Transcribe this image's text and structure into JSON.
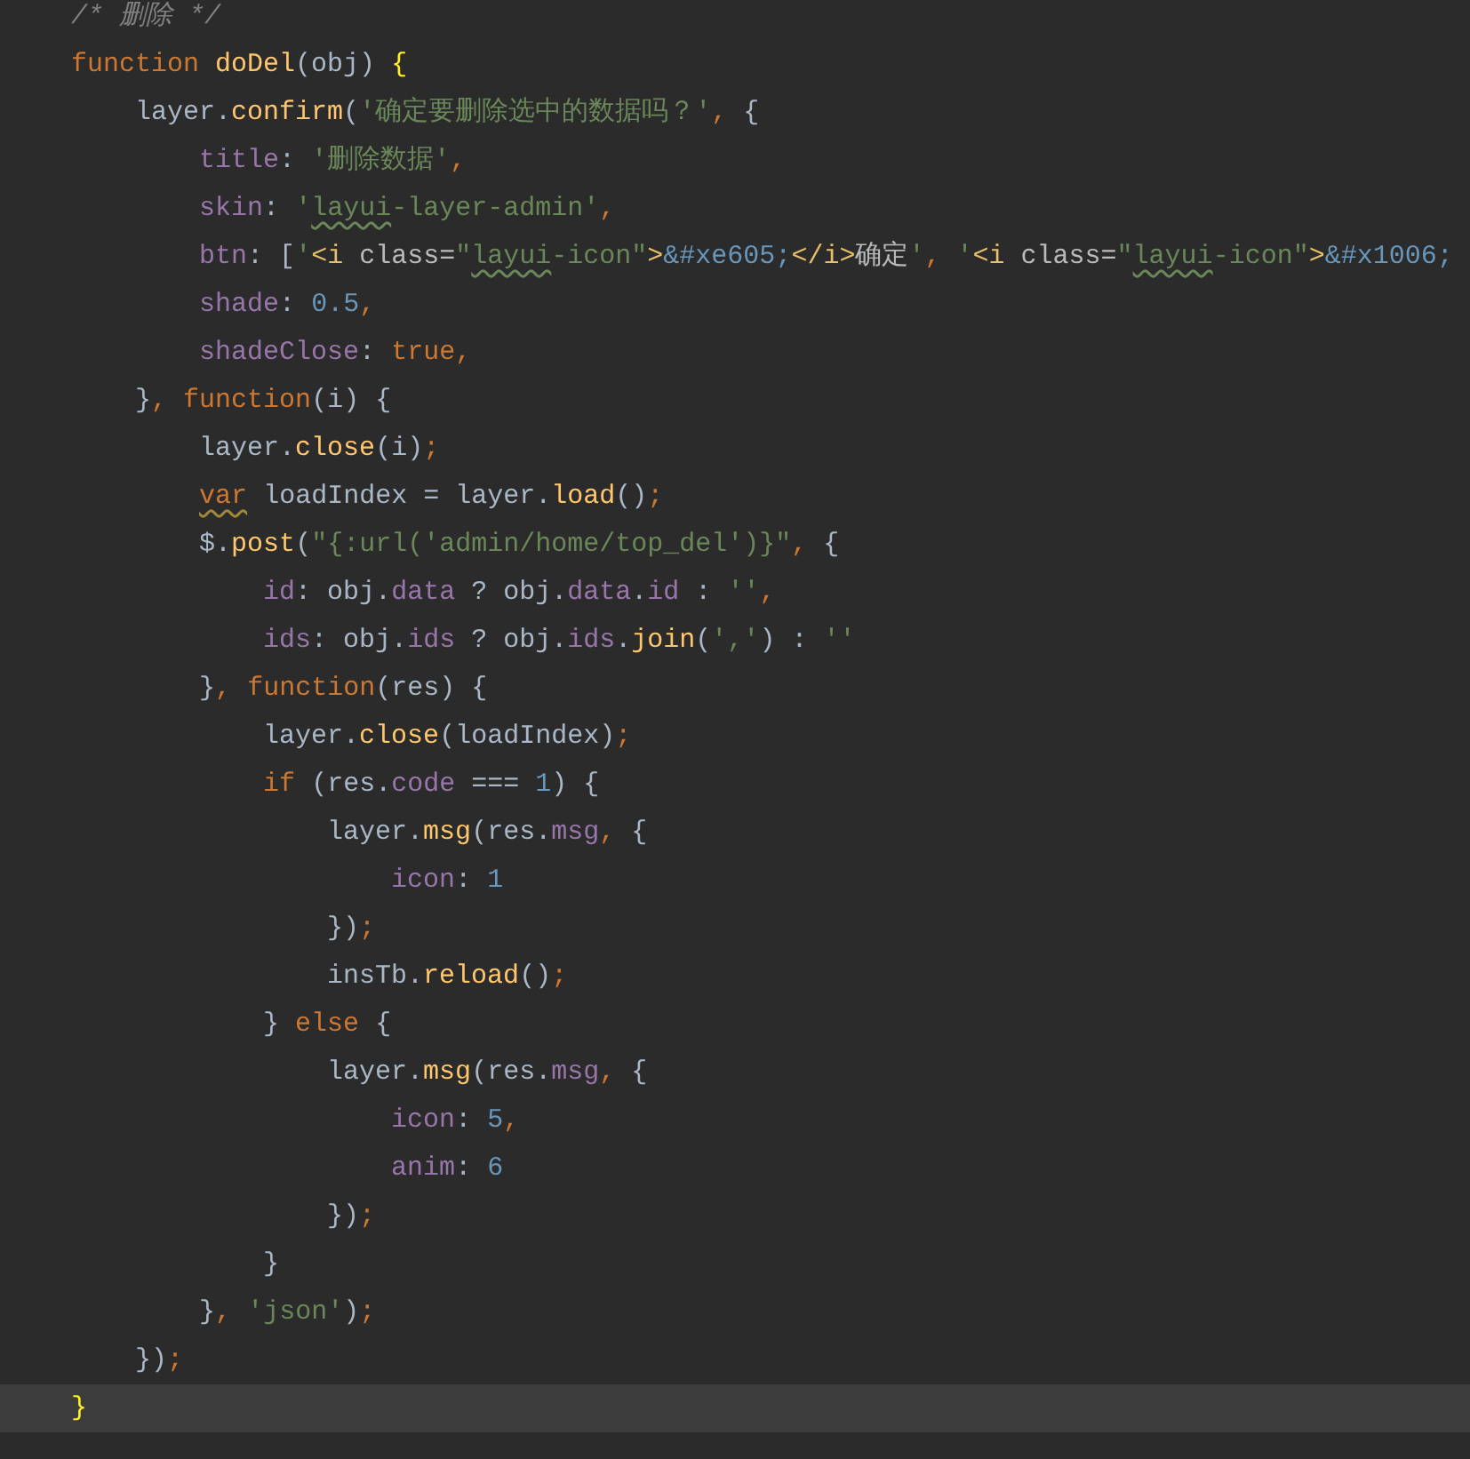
{
  "editor": {
    "lines": [
      {
        "current": false,
        "tokens": [
          {
            "kind": "comment",
            "text": "    /* 删除 */"
          }
        ]
      },
      {
        "current": false,
        "tokens": [
          {
            "kind": "keyword",
            "text": "    function "
          },
          {
            "kind": "fn",
            "text": "doDel"
          },
          {
            "kind": "plain",
            "text": "(obj) "
          },
          {
            "kind": "brace",
            "text": "{"
          }
        ]
      },
      {
        "current": false,
        "tokens": [
          {
            "kind": "plain",
            "text": "        layer."
          },
          {
            "kind": "fn",
            "text": "confirm"
          },
          {
            "kind": "plain",
            "text": "("
          },
          {
            "kind": "string",
            "text": "'确定要删除选中的数据吗？'"
          },
          {
            "kind": "punct",
            "text": ","
          },
          {
            "kind": "plain",
            "text": " {"
          }
        ]
      },
      {
        "current": false,
        "tokens": [
          {
            "kind": "prop",
            "text": "            title"
          },
          {
            "kind": "plain",
            "text": ": "
          },
          {
            "kind": "string",
            "text": "'删除数据'"
          },
          {
            "kind": "punct",
            "text": ","
          }
        ]
      },
      {
        "current": false,
        "tokens": [
          {
            "kind": "prop",
            "text": "            skin"
          },
          {
            "kind": "plain",
            "text": ": "
          },
          {
            "kind": "string",
            "text": "'"
          },
          {
            "kind": "typo-string",
            "text": "layui"
          },
          {
            "kind": "string",
            "text": "-layer-admin'"
          },
          {
            "kind": "punct",
            "text": ","
          }
        ]
      },
      {
        "current": false,
        "tokens": [
          {
            "kind": "prop",
            "text": "            btn"
          },
          {
            "kind": "plain",
            "text": ": ["
          },
          {
            "kind": "string",
            "text": "'"
          },
          {
            "kind": "tag",
            "text": "<i "
          },
          {
            "kind": "attr",
            "text": "class="
          },
          {
            "kind": "string",
            "text": "\""
          },
          {
            "kind": "typo-string",
            "text": "layui"
          },
          {
            "kind": "string",
            "text": "-icon\""
          },
          {
            "kind": "tag",
            "text": ">"
          },
          {
            "kind": "entity",
            "text": "&#xe605;"
          },
          {
            "kind": "tag",
            "text": "</i>"
          },
          {
            "kind": "attr",
            "text": "确定"
          },
          {
            "kind": "string",
            "text": "'"
          },
          {
            "kind": "punct",
            "text": ", "
          },
          {
            "kind": "string",
            "text": "'"
          },
          {
            "kind": "tag",
            "text": "<i "
          },
          {
            "kind": "attr",
            "text": "class="
          },
          {
            "kind": "string",
            "text": "\""
          },
          {
            "kind": "typo-string",
            "text": "layui"
          },
          {
            "kind": "string",
            "text": "-icon\""
          },
          {
            "kind": "tag",
            "text": ">"
          },
          {
            "kind": "entity",
            "text": "&#x1006;"
          }
        ]
      },
      {
        "current": false,
        "tokens": [
          {
            "kind": "prop",
            "text": "            shade"
          },
          {
            "kind": "plain",
            "text": ": "
          },
          {
            "kind": "number",
            "text": "0.5"
          },
          {
            "kind": "punct",
            "text": ","
          }
        ]
      },
      {
        "current": false,
        "tokens": [
          {
            "kind": "prop",
            "text": "            shadeClose"
          },
          {
            "kind": "plain",
            "text": ": "
          },
          {
            "kind": "keyword",
            "text": "true"
          },
          {
            "kind": "punct",
            "text": ","
          }
        ]
      },
      {
        "current": false,
        "tokens": [
          {
            "kind": "plain",
            "text": "        }"
          },
          {
            "kind": "punct",
            "text": ", "
          },
          {
            "kind": "keyword",
            "text": "function"
          },
          {
            "kind": "plain",
            "text": "(i) {"
          }
        ]
      },
      {
        "current": false,
        "tokens": [
          {
            "kind": "plain",
            "text": "            layer."
          },
          {
            "kind": "fn",
            "text": "close"
          },
          {
            "kind": "plain",
            "text": "(i)"
          },
          {
            "kind": "punct",
            "text": ";"
          }
        ]
      },
      {
        "current": false,
        "tokens": [
          {
            "kind": "typo-keyword",
            "text": "            var"
          },
          {
            "kind": "plain",
            "text": " loadIndex = layer."
          },
          {
            "kind": "fn",
            "text": "load"
          },
          {
            "kind": "plain",
            "text": "()"
          },
          {
            "kind": "punct",
            "text": ";"
          }
        ]
      },
      {
        "current": false,
        "tokens": [
          {
            "kind": "plain",
            "text": "            $."
          },
          {
            "kind": "fn",
            "text": "post"
          },
          {
            "kind": "plain",
            "text": "("
          },
          {
            "kind": "string",
            "text": "\"{:url('admin/home/top_del')}\""
          },
          {
            "kind": "punct",
            "text": ","
          },
          {
            "kind": "plain",
            "text": " {"
          }
        ]
      },
      {
        "current": false,
        "tokens": [
          {
            "kind": "prop",
            "text": "                id"
          },
          {
            "kind": "plain",
            "text": ": obj."
          },
          {
            "kind": "prop",
            "text": "data"
          },
          {
            "kind": "plain",
            "text": " ? obj."
          },
          {
            "kind": "prop",
            "text": "data"
          },
          {
            "kind": "plain",
            "text": "."
          },
          {
            "kind": "prop",
            "text": "id"
          },
          {
            "kind": "plain",
            "text": " : "
          },
          {
            "kind": "string",
            "text": "''"
          },
          {
            "kind": "punct",
            "text": ","
          }
        ]
      },
      {
        "current": false,
        "tokens": [
          {
            "kind": "prop",
            "text": "                ids"
          },
          {
            "kind": "plain",
            "text": ": obj."
          },
          {
            "kind": "prop",
            "text": "ids"
          },
          {
            "kind": "plain",
            "text": " ? obj."
          },
          {
            "kind": "prop",
            "text": "ids"
          },
          {
            "kind": "plain",
            "text": "."
          },
          {
            "kind": "fn",
            "text": "join"
          },
          {
            "kind": "plain",
            "text": "("
          },
          {
            "kind": "string",
            "text": "','"
          },
          {
            "kind": "plain",
            "text": ") : "
          },
          {
            "kind": "string",
            "text": "''"
          }
        ]
      },
      {
        "current": false,
        "tokens": [
          {
            "kind": "plain",
            "text": "            }"
          },
          {
            "kind": "punct",
            "text": ", "
          },
          {
            "kind": "keyword",
            "text": "function"
          },
          {
            "kind": "plain",
            "text": "(res) {"
          }
        ]
      },
      {
        "current": false,
        "tokens": [
          {
            "kind": "plain",
            "text": "                layer."
          },
          {
            "kind": "fn",
            "text": "close"
          },
          {
            "kind": "plain",
            "text": "(loadIndex)"
          },
          {
            "kind": "punct",
            "text": ";"
          }
        ]
      },
      {
        "current": false,
        "tokens": [
          {
            "kind": "keyword",
            "text": "                if"
          },
          {
            "kind": "plain",
            "text": " (res."
          },
          {
            "kind": "prop",
            "text": "code"
          },
          {
            "kind": "plain",
            "text": " === "
          },
          {
            "kind": "number",
            "text": "1"
          },
          {
            "kind": "plain",
            "text": ") {"
          }
        ]
      },
      {
        "current": false,
        "tokens": [
          {
            "kind": "plain",
            "text": "                    layer."
          },
          {
            "kind": "fn",
            "text": "msg"
          },
          {
            "kind": "plain",
            "text": "(res."
          },
          {
            "kind": "prop",
            "text": "msg"
          },
          {
            "kind": "punct",
            "text": ","
          },
          {
            "kind": "plain",
            "text": " {"
          }
        ]
      },
      {
        "current": false,
        "tokens": [
          {
            "kind": "prop",
            "text": "                        icon"
          },
          {
            "kind": "plain",
            "text": ": "
          },
          {
            "kind": "number",
            "text": "1"
          }
        ]
      },
      {
        "current": false,
        "tokens": [
          {
            "kind": "plain",
            "text": "                    })"
          },
          {
            "kind": "punct",
            "text": ";"
          }
        ]
      },
      {
        "current": false,
        "tokens": [
          {
            "kind": "plain",
            "text": "                    insTb."
          },
          {
            "kind": "fn",
            "text": "reload"
          },
          {
            "kind": "plain",
            "text": "()"
          },
          {
            "kind": "punct",
            "text": ";"
          }
        ]
      },
      {
        "current": false,
        "tokens": [
          {
            "kind": "plain",
            "text": "                } "
          },
          {
            "kind": "keyword",
            "text": "else"
          },
          {
            "kind": "plain",
            "text": " {"
          }
        ]
      },
      {
        "current": false,
        "tokens": [
          {
            "kind": "plain",
            "text": "                    layer."
          },
          {
            "kind": "fn",
            "text": "msg"
          },
          {
            "kind": "plain",
            "text": "(res."
          },
          {
            "kind": "prop",
            "text": "msg"
          },
          {
            "kind": "punct",
            "text": ","
          },
          {
            "kind": "plain",
            "text": " {"
          }
        ]
      },
      {
        "current": false,
        "tokens": [
          {
            "kind": "prop",
            "text": "                        icon"
          },
          {
            "kind": "plain",
            "text": ": "
          },
          {
            "kind": "number",
            "text": "5"
          },
          {
            "kind": "punct",
            "text": ","
          }
        ]
      },
      {
        "current": false,
        "tokens": [
          {
            "kind": "prop",
            "text": "                        anim"
          },
          {
            "kind": "plain",
            "text": ": "
          },
          {
            "kind": "number",
            "text": "6"
          }
        ]
      },
      {
        "current": false,
        "tokens": [
          {
            "kind": "plain",
            "text": "                    })"
          },
          {
            "kind": "punct",
            "text": ";"
          }
        ]
      },
      {
        "current": false,
        "tokens": [
          {
            "kind": "plain",
            "text": "                }"
          }
        ]
      },
      {
        "current": false,
        "tokens": [
          {
            "kind": "plain",
            "text": "            }"
          },
          {
            "kind": "punct",
            "text": ", "
          },
          {
            "kind": "string",
            "text": "'json'"
          },
          {
            "kind": "plain",
            "text": ")"
          },
          {
            "kind": "punct",
            "text": ";"
          }
        ]
      },
      {
        "current": false,
        "tokens": [
          {
            "kind": "plain",
            "text": "        })"
          },
          {
            "kind": "punct",
            "text": ";"
          }
        ]
      },
      {
        "current": true,
        "tokens": [
          {
            "kind": "brace",
            "text": "    }"
          }
        ]
      }
    ]
  }
}
